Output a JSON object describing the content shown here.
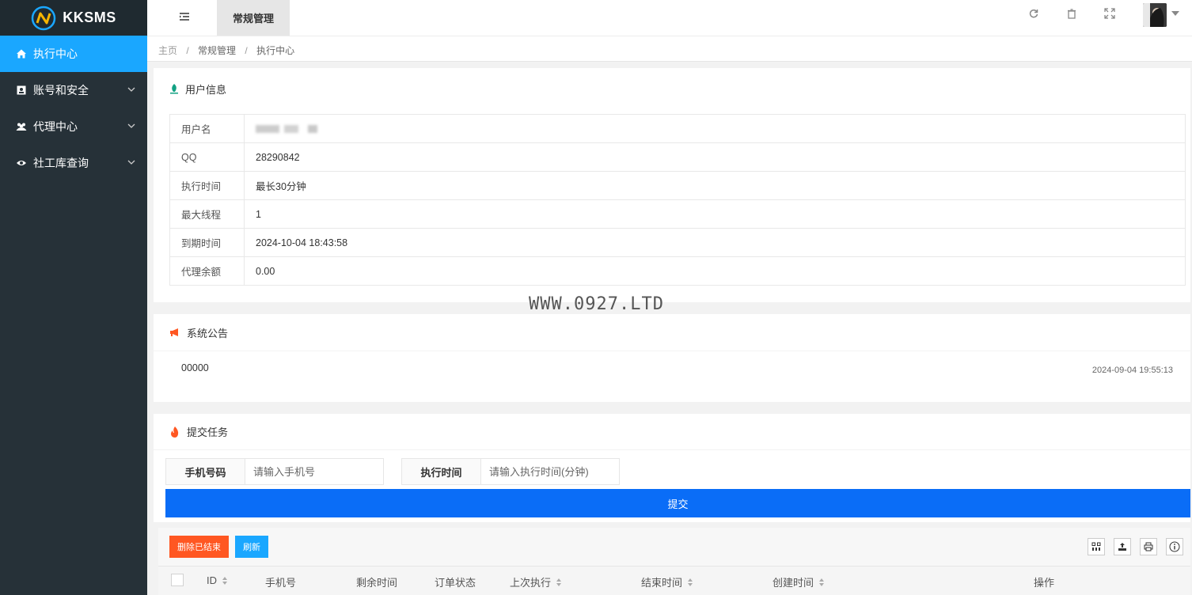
{
  "app": {
    "logo_text": "KKSMS"
  },
  "sidebar": {
    "items": [
      {
        "label": "执行中心",
        "icon": "home-icon",
        "active": true
      },
      {
        "label": "账号和安全",
        "icon": "id-card-icon"
      },
      {
        "label": "代理中心",
        "icon": "users-icon"
      },
      {
        "label": "社工库查询",
        "icon": "eye-icon"
      }
    ]
  },
  "header": {
    "active_tab": "常规管理"
  },
  "breadcrumb": {
    "items": [
      "主页",
      "常规管理",
      "执行中心"
    ]
  },
  "user_info": {
    "title": "用户信息",
    "rows": [
      {
        "key": "用户名",
        "value": ""
      },
      {
        "key": "QQ",
        "value": "28290842"
      },
      {
        "key": "执行时间",
        "value": "最长30分钟"
      },
      {
        "key": "最大线程",
        "value": "1"
      },
      {
        "key": "到期时间",
        "value": "2024-10-04 18:43:58"
      },
      {
        "key": "代理余额",
        "value": "0.00"
      }
    ]
  },
  "watermark": "WWW.0927.LTD",
  "notice": {
    "title": "系统公告",
    "text": "00000",
    "date": "2024-09-04 19:55:13"
  },
  "task": {
    "title": "提交任务",
    "phone_label": "手机号码",
    "phone_placeholder": "请输入手机号",
    "time_label": "执行时间",
    "time_placeholder": "请输入执行时间(分钟)",
    "submit_label": "提交"
  },
  "table": {
    "delete_finished_label": "删除已结束",
    "refresh_label": "刷新",
    "columns": [
      "ID",
      "手机号",
      "剩余时间",
      "订单状态",
      "上次执行",
      "结束时间",
      "创建时间",
      "操作"
    ]
  },
  "colors": {
    "sidebar": "#263138",
    "active": "#1aa7ff",
    "primary": "#0a6df7",
    "danger": "#ff5722"
  }
}
